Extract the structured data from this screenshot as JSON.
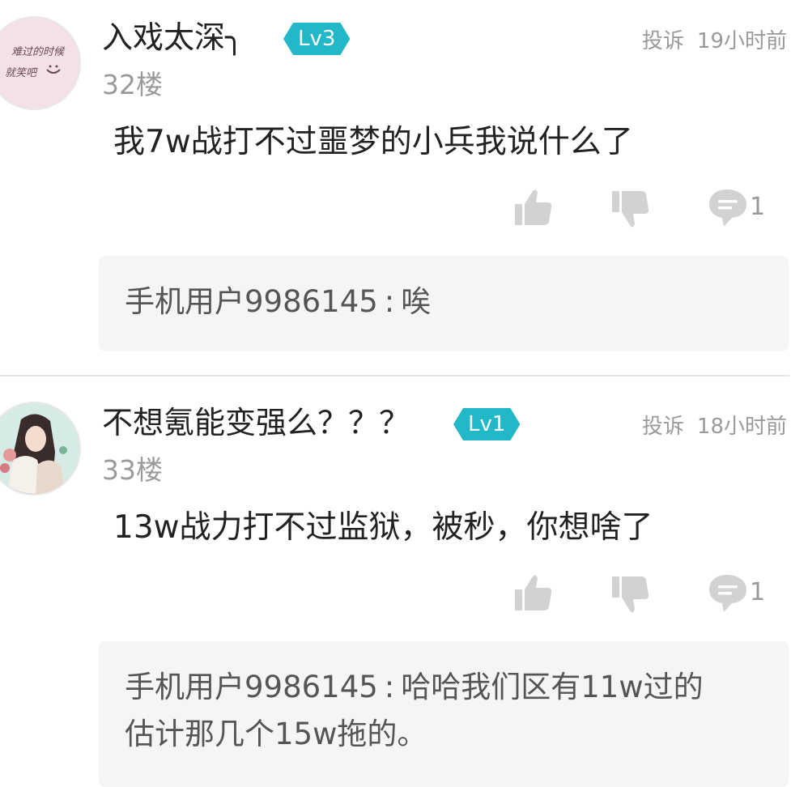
{
  "comments": [
    {
      "username": "入戏太深╮",
      "level": "Lv3",
      "report": "投诉",
      "time": "19小时前",
      "floor": "32楼",
      "text": "我7w战打不过噩梦的小兵我说什么了",
      "reply_count": "1",
      "avatar_text": [
        "难过的时候",
        "就笑吧"
      ],
      "reply": {
        "user": "手机用户9986145",
        "colon": ":",
        "text": "唉",
        "text2": ""
      }
    },
    {
      "username": "不想氪能变强么？？？",
      "level": "Lv1",
      "report": "投诉",
      "time": "18小时前",
      "floor": "33楼",
      "text": "13w战力打不过监狱，被秒，你想啥了",
      "reply_count": "1",
      "reply": {
        "user": "手机用户9986145",
        "colon": ":",
        "text": "哈哈我们区有11w过的",
        "text2": "估计那几个15w拖的。"
      }
    }
  ],
  "icons": {
    "like": "thumbs-up-icon",
    "dislike": "thumbs-down-icon",
    "reply": "comment-bubble-icon"
  },
  "colors": {
    "level_badge": "#22b8c8",
    "muted_text": "#9a9a9a",
    "icon_gray": "#d2d2d2",
    "reply_bg": "#f5f5f5"
  }
}
